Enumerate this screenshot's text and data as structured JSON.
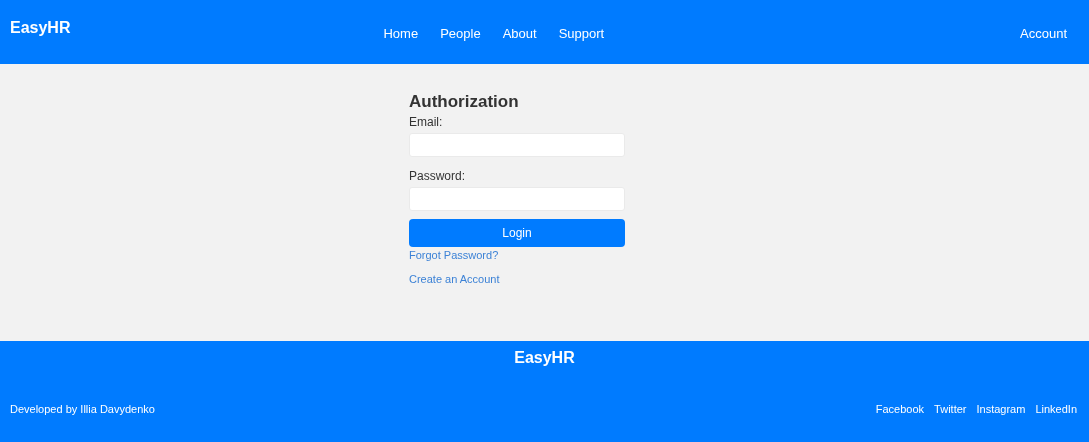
{
  "header": {
    "logo": "EasyHR",
    "nav": [
      "Home",
      "People",
      "About",
      "Support"
    ],
    "account": "Account"
  },
  "form": {
    "title": "Authorization",
    "fields": [
      {
        "label": "Email:"
      },
      {
        "label": "Password:"
      }
    ],
    "button": "Login",
    "links": [
      "Forgot Password?",
      "Create an Account"
    ]
  },
  "footer": {
    "title": "EasyHR",
    "credit": "Developed by Illia Davydenko",
    "links": [
      "Facebook",
      "Twitter",
      "Instagram",
      "LinkedIn"
    ]
  }
}
